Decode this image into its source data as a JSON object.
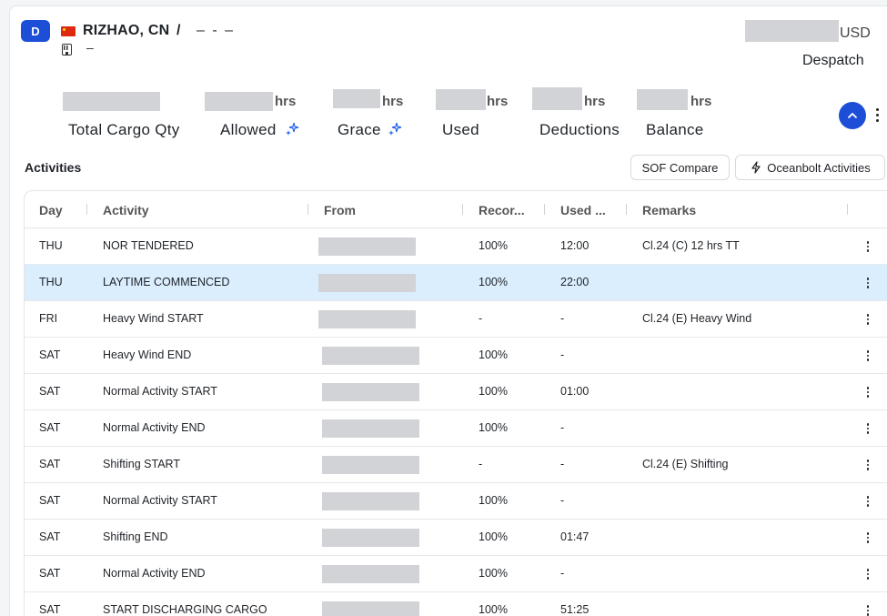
{
  "header": {
    "badge": "D",
    "port": "RIZHAO, CN",
    "separator": "/",
    "port_suffix": "– - –",
    "terminal": "–",
    "currency": "USD",
    "result_label": "Despatch"
  },
  "summary": {
    "unit": "hrs",
    "items": [
      {
        "label": "Total Cargo Qty"
      },
      {
        "label": "Allowed"
      },
      {
        "label": "Grace"
      },
      {
        "label": "Used"
      },
      {
        "label": "Deductions"
      },
      {
        "label": "Balance"
      }
    ]
  },
  "activities": {
    "title": "Activities",
    "sof_compare_label": "SOF Compare",
    "oceanbolt_label": "Oceanbolt Activities",
    "columns": [
      "Day",
      "Activity",
      "From",
      "Recor...",
      "Used ...",
      "Remarks"
    ],
    "rows": [
      {
        "day": "THU",
        "activity": "NOR TENDERED",
        "record": "100%",
        "used": "12:00",
        "remarks": "Cl.24 (C) 12 hrs TT"
      },
      {
        "day": "THU",
        "activity": "LAYTIME COMMENCED",
        "record": "100%",
        "used": "22:00",
        "remarks": ""
      },
      {
        "day": "FRI",
        "activity": "Heavy Wind START",
        "record": "-",
        "used": "-",
        "remarks": "Cl.24 (E) Heavy Wind"
      },
      {
        "day": "SAT",
        "activity": "Heavy Wind END",
        "record": "100%",
        "used": "-",
        "remarks": ""
      },
      {
        "day": "SAT",
        "activity": "Normal Activity START",
        "record": "100%",
        "used": "01:00",
        "remarks": ""
      },
      {
        "day": "SAT",
        "activity": "Normal Activity END",
        "record": "100%",
        "used": "-",
        "remarks": ""
      },
      {
        "day": "SAT",
        "activity": "Shifting START",
        "record": "-",
        "used": "-",
        "remarks": "Cl.24 (E) Shifting"
      },
      {
        "day": "SAT",
        "activity": "Normal Activity START",
        "record": "100%",
        "used": "-",
        "remarks": ""
      },
      {
        "day": "SAT",
        "activity": "Shifting END",
        "record": "100%",
        "used": "01:47",
        "remarks": ""
      },
      {
        "day": "SAT",
        "activity": "Normal Activity END",
        "record": "100%",
        "used": "-",
        "remarks": ""
      },
      {
        "day": "SAT",
        "activity": "START DISCHARGING CARGO",
        "record": "100%",
        "used": "51:25",
        "remarks": ""
      }
    ]
  },
  "colors": {
    "accent": "#1d4ed8",
    "selected_row": "#dbeefe",
    "redaction": "#d1d3d6"
  },
  "icons": [
    "flag-cn-icon",
    "building-icon",
    "sparkle-icon",
    "chevron-up-icon",
    "kebab-menu-icon",
    "lightning-icon"
  ]
}
